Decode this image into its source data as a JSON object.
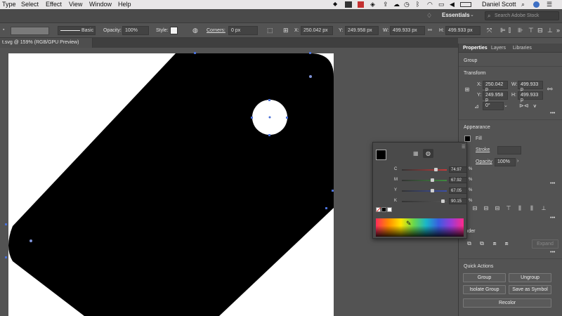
{
  "menubar": {
    "items": [
      "Type",
      "Select",
      "Effect",
      "View",
      "Window",
      "Help"
    ],
    "user": "Daniel Scott"
  },
  "appbar": {
    "workspace": "Essentials",
    "search_placeholder": "Search Adobe Stock"
  },
  "controlbar": {
    "stroke_profile": "Basic",
    "opacity_label": "Opacity:",
    "opacity_value": "100%",
    "style_label": "Style:",
    "corners_label": "Corners:",
    "corners_value": "0 px",
    "x_label": "X:",
    "x_value": "250.042 px",
    "y_label": "Y:",
    "y_value": "249.958 px",
    "w_label": "W:",
    "w_value": "499.933 px",
    "h_label": "H:",
    "h_value": "499.933 px"
  },
  "document": {
    "tab_title": "t.svg @ 159% (RGB/GPU Preview)"
  },
  "panel": {
    "tabs": [
      "Properties",
      "Layers",
      "Libraries"
    ],
    "selection_type": "Group",
    "transform_title": "Transform",
    "x_label": "X:",
    "x_value": "250.042 p",
    "y_label": "Y:",
    "y_value": "249.958 p",
    "w_label": "W:",
    "w_value": "499.933 p",
    "h_label": "H:",
    "h_value": "499.933 p",
    "rotate_value": "0°",
    "appearance_title": "Appearance",
    "fill_label": "Fill",
    "stroke_label": "Stroke",
    "opacity_label": "Opacity",
    "opacity_value": "100%",
    "pathfinder_title": "finder",
    "expand_label": "Expand",
    "quick_actions_title": "Quick Actions",
    "buttons": {
      "group": "Group",
      "ungroup": "Ungroup",
      "isolate_group": "Isolate Group",
      "save_as_symbol": "Save as Symbol",
      "recolor": "Recolor"
    }
  },
  "color_popup": {
    "channels": [
      {
        "label": "C",
        "value": "74.97",
        "unit": "%",
        "level": 0.7497,
        "color": "#c63a3a"
      },
      {
        "label": "M",
        "value": "67.92",
        "unit": "%",
        "level": 0.6792,
        "color": "#3f8a3f"
      },
      {
        "label": "Y",
        "value": "67.05",
        "unit": "%",
        "level": 0.6705,
        "color": "#3b4fa8"
      },
      {
        "label": "K",
        "value": "90.15",
        "unit": "%",
        "level": 0.9015,
        "color": "#555555"
      }
    ]
  },
  "colors": {
    "accent": "#4a6fd6",
    "fill": "#000000"
  }
}
